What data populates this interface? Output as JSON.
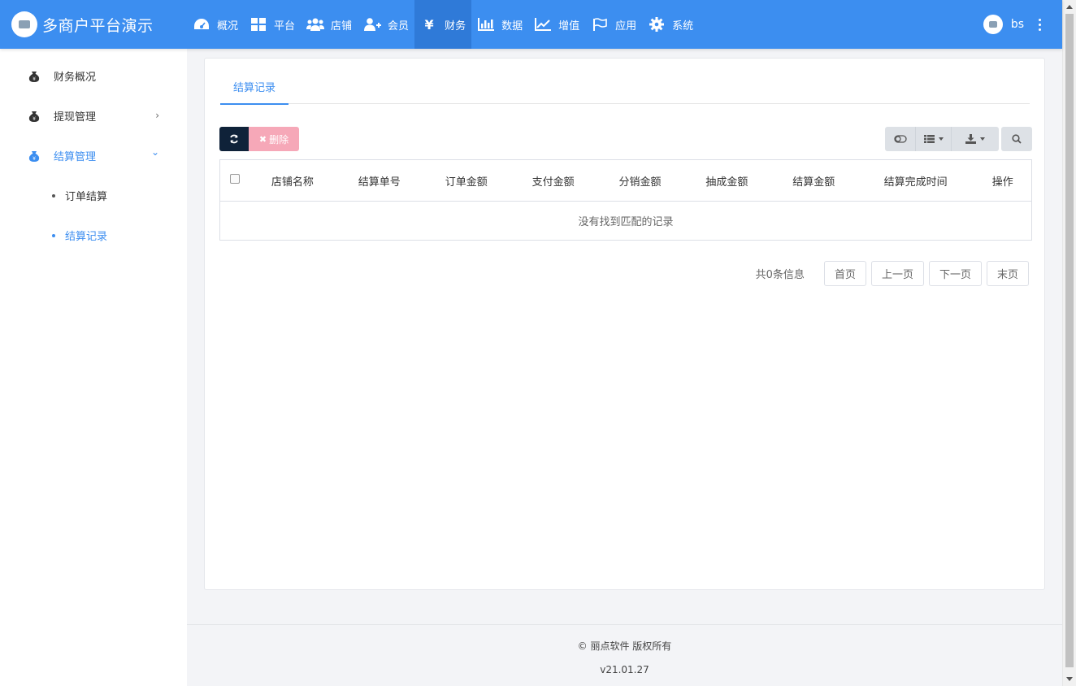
{
  "brand": {
    "title": "多商户平台演示"
  },
  "nav": [
    {
      "label": "概况",
      "icon": "dashboard-icon"
    },
    {
      "label": "平台",
      "icon": "grid-icon"
    },
    {
      "label": "店铺",
      "icon": "users-icon"
    },
    {
      "label": "会员",
      "icon": "user-plus-icon"
    },
    {
      "label": "财务",
      "icon": "yen-icon",
      "active": true
    },
    {
      "label": "数据",
      "icon": "bar-chart-icon"
    },
    {
      "label": "增值",
      "icon": "line-chart-icon"
    },
    {
      "label": "应用",
      "icon": "flag-icon"
    },
    {
      "label": "系统",
      "icon": "gear-icon"
    }
  ],
  "user": {
    "name": "bs"
  },
  "sidebar": {
    "items": [
      {
        "label": "财务概况",
        "icon": "money-bag-icon"
      },
      {
        "label": "提现管理",
        "icon": "money-bag-icon",
        "arrow": "›"
      },
      {
        "label": "结算管理",
        "icon": "money-bag-icon",
        "arrow": "⌄",
        "active": true
      }
    ],
    "subitems": [
      {
        "label": "订单结算"
      },
      {
        "label": "结算记录",
        "active": true
      }
    ]
  },
  "tabs": [
    {
      "label": "结算记录"
    }
  ],
  "toolbar": {
    "delete_label": "删除"
  },
  "table": {
    "columns": [
      "店铺名称",
      "结算单号",
      "订单金额",
      "支付金额",
      "分销金额",
      "抽成金额",
      "结算金额",
      "结算完成时间",
      "操作"
    ],
    "empty_text": "没有找到匹配的记录"
  },
  "pager": {
    "info": "共0条信息",
    "first": "首页",
    "prev": "上一页",
    "next": "下一页",
    "last": "末页"
  },
  "footer": {
    "copyright": "© 丽点软件 版权所有",
    "version": "v21.01.27"
  },
  "colors": {
    "primary": "#3c8ef0",
    "nav_active": "#2f7ad8",
    "dark_button": "#0f2239",
    "delete_button": "#f6a8b8"
  }
}
